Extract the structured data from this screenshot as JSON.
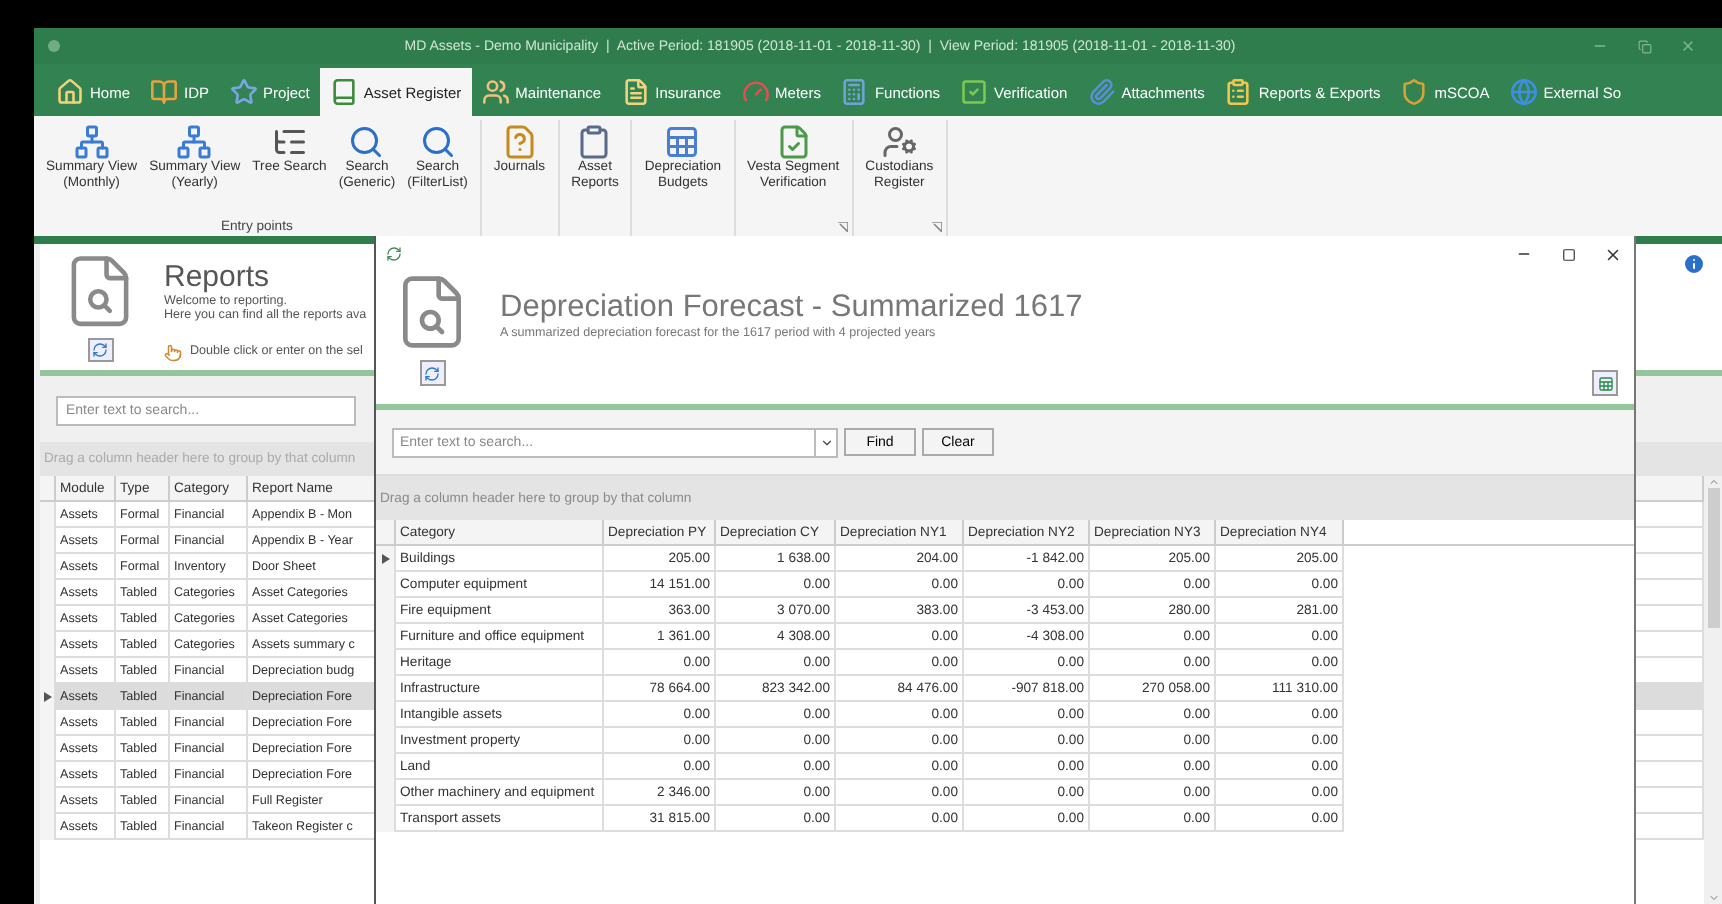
{
  "window": {
    "title": "MD Assets - Demo Municipality  |  Active Period: 181905 (2018-11-01 - 2018-11-30)  |  View Period: 181905 (2018-11-01 - 2018-11-30)"
  },
  "tabs": [
    {
      "label": "Home",
      "selected": false
    },
    {
      "label": "IDP",
      "selected": false
    },
    {
      "label": "Project",
      "selected": false
    },
    {
      "label": "Asset Register",
      "selected": true
    },
    {
      "label": "Maintenance",
      "selected": false
    },
    {
      "label": "Insurance",
      "selected": false
    },
    {
      "label": "Meters",
      "selected": false
    },
    {
      "label": "Functions",
      "selected": false
    },
    {
      "label": "Verification",
      "selected": false
    },
    {
      "label": "Attachments",
      "selected": false
    },
    {
      "label": "Reports & Exports",
      "selected": false
    },
    {
      "label": "mSCOA",
      "selected": false
    },
    {
      "label": "External So",
      "selected": false
    }
  ],
  "ribbon": {
    "groups": [
      {
        "label": "Entry points",
        "buttons": [
          [
            "Summary View",
            "(Monthly)"
          ],
          [
            "Summary View",
            "(Yearly)"
          ],
          [
            "Tree Search"
          ],
          [
            "Search",
            "(Generic)"
          ],
          [
            "Search",
            "(FilterList)"
          ]
        ]
      },
      {
        "buttons": [
          [
            "Journals"
          ]
        ]
      },
      {
        "buttons": [
          [
            "Asset",
            "Reports"
          ]
        ]
      },
      {
        "buttons": [
          [
            "Depreciation",
            "Budgets"
          ]
        ]
      },
      {
        "launcher": true,
        "buttons": [
          [
            "Vesta Segment",
            "Verification"
          ]
        ]
      },
      {
        "launcher": true,
        "buttons": [
          [
            "Custodians",
            "Register"
          ]
        ]
      }
    ]
  },
  "reports": {
    "title": "Reports",
    "intro": [
      "Welcome to reporting.",
      "Here you can find all the reports ava"
    ],
    "hint": "Double click or enter on the sel",
    "search": {
      "placeholder": "Enter text to search..."
    },
    "group_panel": "Drag a column header here to group by that column",
    "columns": [
      "Module",
      "Type",
      "Category",
      "Report Name"
    ],
    "rows": [
      {
        "cells": [
          "Assets",
          "Formal",
          "Financial",
          "Appendix B - Mon"
        ],
        "selected": false
      },
      {
        "cells": [
          "Assets",
          "Formal",
          "Financial",
          "Appendix B - Year"
        ],
        "selected": false
      },
      {
        "cells": [
          "Assets",
          "Formal",
          "Inventory",
          "Door Sheet"
        ],
        "selected": false
      },
      {
        "cells": [
          "Assets",
          "Tabled",
          "Categories",
          "Asset Categories"
        ],
        "selected": false
      },
      {
        "cells": [
          "Assets",
          "Tabled",
          "Categories",
          "Asset Categories"
        ],
        "selected": false
      },
      {
        "cells": [
          "Assets",
          "Tabled",
          "Categories",
          "Assets summary c"
        ],
        "selected": false
      },
      {
        "cells": [
          "Assets",
          "Tabled",
          "Financial",
          "Depreciation budg"
        ],
        "selected": false
      },
      {
        "cells": [
          "Assets",
          "Tabled",
          "Financial",
          "Depreciation Fore"
        ],
        "selected": true
      },
      {
        "cells": [
          "Assets",
          "Tabled",
          "Financial",
          "Depreciation Fore"
        ],
        "selected": false
      },
      {
        "cells": [
          "Assets",
          "Tabled",
          "Financial",
          "Depreciation Fore"
        ],
        "selected": false
      },
      {
        "cells": [
          "Assets",
          "Tabled",
          "Financial",
          "Depreciation Fore"
        ],
        "selected": false
      },
      {
        "cells": [
          "Assets",
          "Tabled",
          "Financial",
          "Full Register"
        ],
        "selected": false
      },
      {
        "cells": [
          "Assets",
          "Tabled",
          "Financial",
          "Takeon Register c"
        ],
        "selected": false
      }
    ]
  },
  "dialog": {
    "title": "Depreciation Forecast - Summarized 1617",
    "subtitle": "A summarized depreciation forecast for the 1617 period with 4 projected years",
    "search": {
      "placeholder": "Enter text to search..."
    },
    "buttons": [
      "Find",
      "Clear"
    ],
    "group_panel": "Drag a column header here to group by that column",
    "columns": [
      "Category",
      "Depreciation PY",
      "Depreciation CY",
      "Depreciation NY1",
      "Depreciation NY2",
      "Depreciation NY3",
      "Depreciation NY4"
    ],
    "rows": [
      {
        "cells": [
          "Buildings",
          "205.00",
          "1 638.00",
          "204.00",
          "-1 842.00",
          "205.00",
          "205.00"
        ],
        "selected": true
      },
      {
        "cells": [
          "Computer equipment",
          "14 151.00",
          "0.00",
          "0.00",
          "0.00",
          "0.00",
          "0.00"
        ],
        "selected": false
      },
      {
        "cells": [
          "Fire equipment",
          "363.00",
          "3 070.00",
          "383.00",
          "-3 453.00",
          "280.00",
          "281.00"
        ],
        "selected": false
      },
      {
        "cells": [
          "Furniture and office equipment",
          "1 361.00",
          "4 308.00",
          "0.00",
          "-4 308.00",
          "0.00",
          "0.00"
        ],
        "selected": false
      },
      {
        "cells": [
          "Heritage",
          "0.00",
          "0.00",
          "0.00",
          "0.00",
          "0.00",
          "0.00"
        ],
        "selected": false
      },
      {
        "cells": [
          "Infrastructure",
          "78 664.00",
          "823 342.00",
          "84 476.00",
          "-907 818.00",
          "270 058.00",
          "111 310.00"
        ],
        "selected": false
      },
      {
        "cells": [
          "Intangible assets",
          "0.00",
          "0.00",
          "0.00",
          "0.00",
          "0.00",
          "0.00"
        ],
        "selected": false
      },
      {
        "cells": [
          "Investment property",
          "0.00",
          "0.00",
          "0.00",
          "0.00",
          "0.00",
          "0.00"
        ],
        "selected": false
      },
      {
        "cells": [
          "Land",
          "0.00",
          "0.00",
          "0.00",
          "0.00",
          "0.00",
          "0.00"
        ],
        "selected": false
      },
      {
        "cells": [
          "Other machinery and equipment",
          "2 346.00",
          "0.00",
          "0.00",
          "0.00",
          "0.00",
          "0.00"
        ],
        "selected": false
      },
      {
        "cells": [
          "Transport assets",
          "31 815.00",
          "0.00",
          "0.00",
          "0.00",
          "0.00",
          "0.00"
        ],
        "selected": false
      }
    ]
  }
}
